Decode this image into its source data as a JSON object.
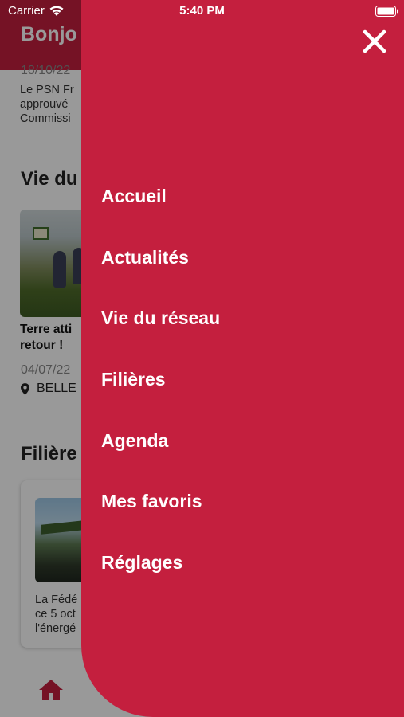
{
  "status_bar": {
    "carrier": "Carrier",
    "time": "5:40 PM"
  },
  "background": {
    "header_title": "Bonjo",
    "news_date": "18/10/22",
    "news_lines": [
      "Le PSN Fr",
      "approuvé",
      "Commissi"
    ],
    "section_network_title": "Vie du",
    "network_card_title_lines": [
      "Terre atti",
      "retour !"
    ],
    "network_card_date": "04/07/22",
    "network_card_location": "BELLE",
    "section_filieres_title": "Filière",
    "filiere_card_lines": [
      "La Fédé",
      "ce 5 oct",
      "l'énergé"
    ],
    "accent_color": "#c41f3e"
  },
  "drawer": {
    "background_color": "#c41f3e",
    "close_icon": "close-icon",
    "items": [
      {
        "label": "Accueil"
      },
      {
        "label": "Actualités"
      },
      {
        "label": "Vie du réseau"
      },
      {
        "label": "Filières"
      },
      {
        "label": "Agenda"
      },
      {
        "label": "Mes favoris"
      },
      {
        "label": "Réglages"
      }
    ]
  },
  "tab_bar": {
    "home_icon": "home-icon"
  }
}
